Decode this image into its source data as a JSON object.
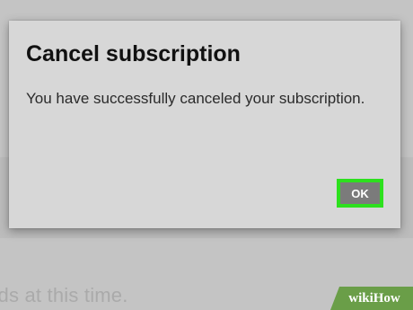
{
  "dialog": {
    "title": "Cancel subscription",
    "message": "You have successfully canceled your subscription.",
    "ok_label": "OK"
  },
  "background": {
    "partial_text": "rds at this time."
  },
  "watermark": {
    "part1": "wiki",
    "part2": "How"
  },
  "colors": {
    "dialog_bg": "#d7d7d7",
    "button_bg": "#7b7b7b",
    "highlight": "#2de01e",
    "watermark_bg": "#6a9e48"
  }
}
